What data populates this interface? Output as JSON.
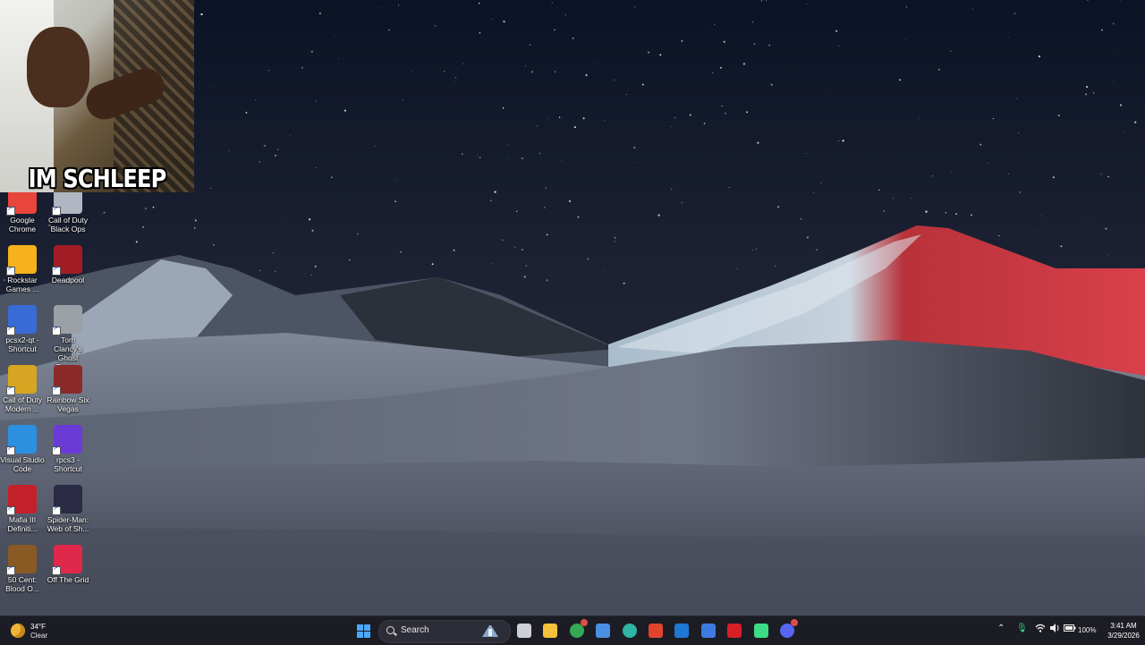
{
  "overlay": {
    "caption": "IM SCHLEEP"
  },
  "desktop_icons": [
    {
      "label": "Google Chrome",
      "icon": "chrome-icon",
      "color": "#e8453c"
    },
    {
      "label": "Call of Duty Black Ops",
      "icon": "black-ops-icon",
      "color": "#b0b6c2"
    },
    {
      "label": "Rockstar Games ...",
      "icon": "rockstar-icon",
      "color": "#f6b21b"
    },
    {
      "label": "Deadpool",
      "icon": "deadpool-icon",
      "color": "#a21d23"
    },
    {
      "label": "pcsx2-qt - Shortcut",
      "icon": "pcsx2-icon",
      "color": "#3a6ad6"
    },
    {
      "label": "Tom Clancy's Ghost Reco...",
      "icon": "ghost-recon-icon",
      "color": "#9aa0a6"
    },
    {
      "label": "Call of Duty Modern ...",
      "icon": "modern-warfare-icon",
      "color": "#d6a521"
    },
    {
      "label": "Rainbow Six Vegas",
      "icon": "rainbow-six-icon",
      "color": "#8b2a2a"
    },
    {
      "label": "Visual Studio Code",
      "icon": "vscode-icon",
      "color": "#2c8fe0"
    },
    {
      "label": "rpcs3 - Shortcut",
      "icon": "rpcs3-icon",
      "color": "#6c3ad6"
    },
    {
      "label": "Mafia III Definiti...",
      "icon": "mafia-icon",
      "color": "#c4202a"
    },
    {
      "label": "Spider-Man: Web of Sh...",
      "icon": "spiderman-icon",
      "color": "#2a2a44"
    },
    {
      "label": "50 Cent: Blood O...",
      "icon": "fifty-cent-icon",
      "color": "#8a5a24"
    },
    {
      "label": "Off The Grid",
      "icon": "off-the-grid-icon",
      "color": "#e0284a"
    }
  ],
  "taskbar": {
    "weather": {
      "temp": "34°F",
      "condition": "Clear"
    },
    "search_placeholder": "Search",
    "apps": [
      {
        "name": "task-view",
        "color": "#cfcfd8"
      },
      {
        "name": "file-explorer",
        "color": "#f3c13a"
      },
      {
        "name": "chrome",
        "color": "#34a853"
      },
      {
        "name": "microsoft-store",
        "color": "#4a90e2"
      },
      {
        "name": "edge",
        "color": "#2fb5a5"
      },
      {
        "name": "brave",
        "color": "#e0442c"
      },
      {
        "name": "outlook",
        "color": "#1e78d4"
      },
      {
        "name": "notes",
        "color": "#3d7be0"
      },
      {
        "name": "ruby-app",
        "color": "#d81f26"
      },
      {
        "name": "android-app",
        "color": "#3ddc84"
      },
      {
        "name": "discord",
        "color": "#5865f2"
      }
    ],
    "battery": "100%",
    "time": "3:41 AM",
    "date": "3/29/2026"
  }
}
